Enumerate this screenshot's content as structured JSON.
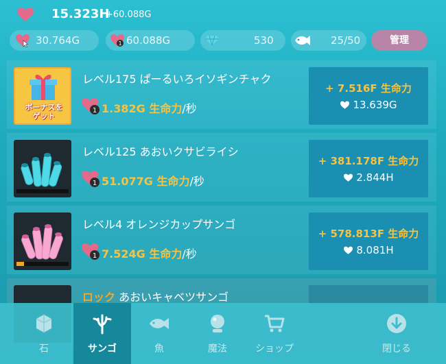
{
  "header": {
    "life_total": "15.323H",
    "life_rate": "+60.088G",
    "tap_value": "30.764G",
    "per_second": "60.088G",
    "gem_count": "530",
    "fish_count": "25/50",
    "manage_label": "管理"
  },
  "rows": [
    {
      "title": "レベル175 ぱーるいろイソギンチャク",
      "rate_value": "1.382G",
      "rate_unit_word": "生命力",
      "rate_suffix": "/秒",
      "cost": "+ 7.516F 生命力",
      "gain": "13.639G",
      "bonus_label": "ボーナスを\nゲット",
      "progress": 0
    },
    {
      "title": "レベル125 あおいクサビライシ",
      "rate_value": "51.077G",
      "rate_unit_word": "生命力",
      "rate_suffix": "/秒",
      "cost": "+ 381.178F 生命力",
      "gain": "2.844H",
      "progress": 0
    },
    {
      "title": "レベル4 オレンジカップサンゴ",
      "rate_value": "7.524G",
      "rate_unit_word": "生命力",
      "rate_suffix": "/秒",
      "cost": "+ 578.813F 生命力",
      "gain": "8.081H",
      "progress": 0.15
    },
    {
      "lock_label": "ロック",
      "title": "あおいキャベツサンゴ"
    }
  ],
  "nav": [
    {
      "label": "石",
      "icon": "stone-icon"
    },
    {
      "label": "サンゴ",
      "icon": "coral-icon"
    },
    {
      "label": "魚",
      "icon": "fish-icon"
    },
    {
      "label": "魔法",
      "icon": "crystal-ball-icon"
    },
    {
      "label": "ショップ",
      "icon": "cart-icon"
    },
    {
      "label": "閉じる",
      "icon": "close-arrow-icon"
    }
  ],
  "colors": {
    "accent_gold": "#f6c342",
    "manage_button": "#b884a7",
    "action_button": "#1a8fb1",
    "heart": "#e36a8a"
  }
}
